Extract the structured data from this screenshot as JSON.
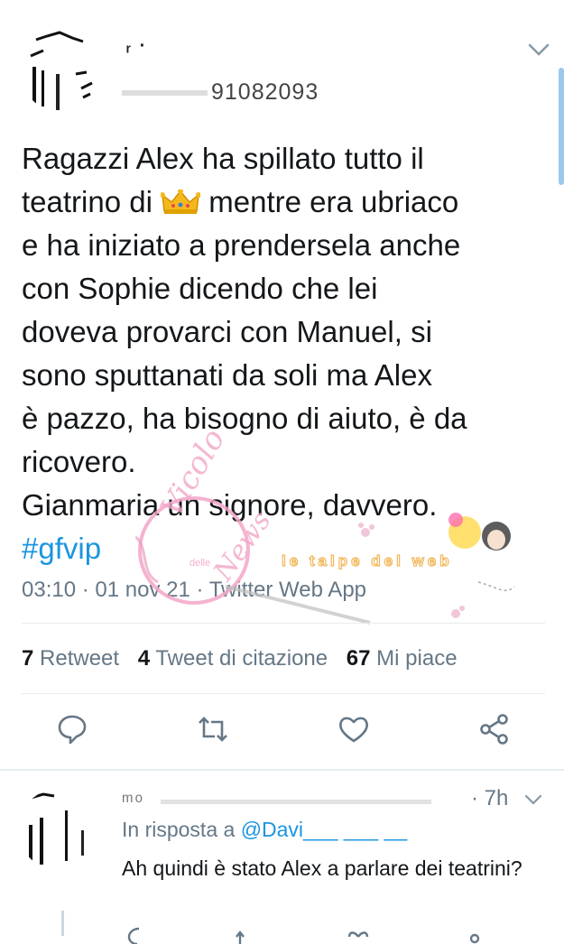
{
  "tweet": {
    "display_name": "ᵣ ·",
    "handle": "91082093",
    "body_lines": [
      "Ragazzi Alex ha spillato tutto il",
      "teatrino di ",
      " mentre era ubriaco",
      "e ha iniziato a prendersela anche",
      "con Sophie dicendo che lei",
      "doveva provarci con Manuel, si",
      "sono sputtanati da soli ma Alex",
      "è pazzo, ha bisogno di aiuto, è da",
      "ricovero.",
      "Gianmaria un signore, davvero."
    ],
    "hashtag": "#gfvip",
    "emoji_icon": "crown-emoji",
    "meta": "03:10 · 01 nov 21 · Twitter Web App",
    "stats": {
      "retweets_count": "7",
      "retweets_label": "Retweet",
      "quotes_count": "4",
      "quotes_label": "Tweet di citazione",
      "likes_count": "67",
      "likes_label": "Mi piace"
    },
    "actions": [
      "reply-icon",
      "retweet-icon",
      "like-icon",
      "share-icon"
    ]
  },
  "watermark": {
    "left_text": "Vicolo",
    "left_small": "delle",
    "left_bottom": "News",
    "right_text": "le talpe del web"
  },
  "reply": {
    "display_name": "ᵐᵒ",
    "time": "7h",
    "in_reply_prefix": "In risposta a ",
    "in_reply_mention": "@Davi___ ___ __",
    "text": "Ah quindi è stato Alex a parlare dei teatrini?"
  },
  "colors": {
    "link": "#1b95e0",
    "secondary_text": "#657786",
    "primary_text": "#14171a",
    "divider": "#e6ecf0",
    "watermark_pink": "#f2a6c8"
  }
}
